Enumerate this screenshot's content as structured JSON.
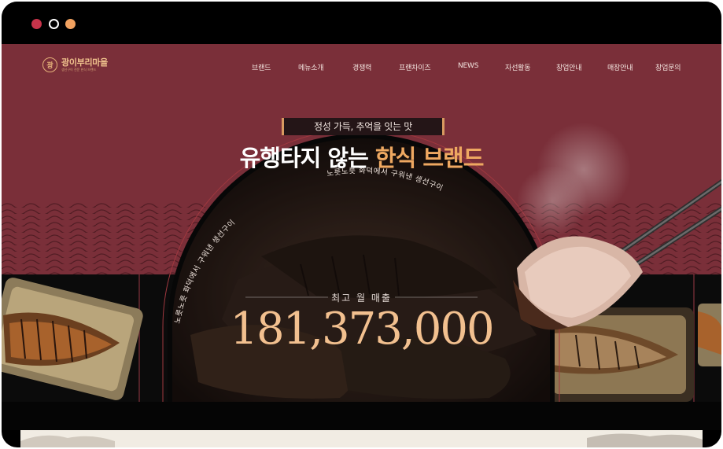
{
  "window": {
    "controls": [
      "close",
      "minimize",
      "maximize"
    ]
  },
  "brand": {
    "logo_char": "광",
    "name": "광이부리마을",
    "subtitle": "생선구이 전문 한식 브랜드"
  },
  "nav": {
    "items": [
      "브랜드",
      "메뉴소개",
      "경쟁력",
      "프랜차이즈",
      "NEWS",
      "자선활동",
      "창업안내",
      "매장안내",
      "창업문의"
    ]
  },
  "hero": {
    "tagline": "정성 가득, 추억을 잇는 맛",
    "headline_main": "유행타지 않는 ",
    "headline_accent": "한식 브랜드",
    "arc_text": "노릇노릇 화덕에서 구워낸 생선구이",
    "sales_label": "최고 월 매출",
    "sales_value": "181,373,000"
  },
  "colors": {
    "hero_bg": "#7a2f39",
    "accent": "#eea861",
    "gold": "#f2c08f"
  }
}
